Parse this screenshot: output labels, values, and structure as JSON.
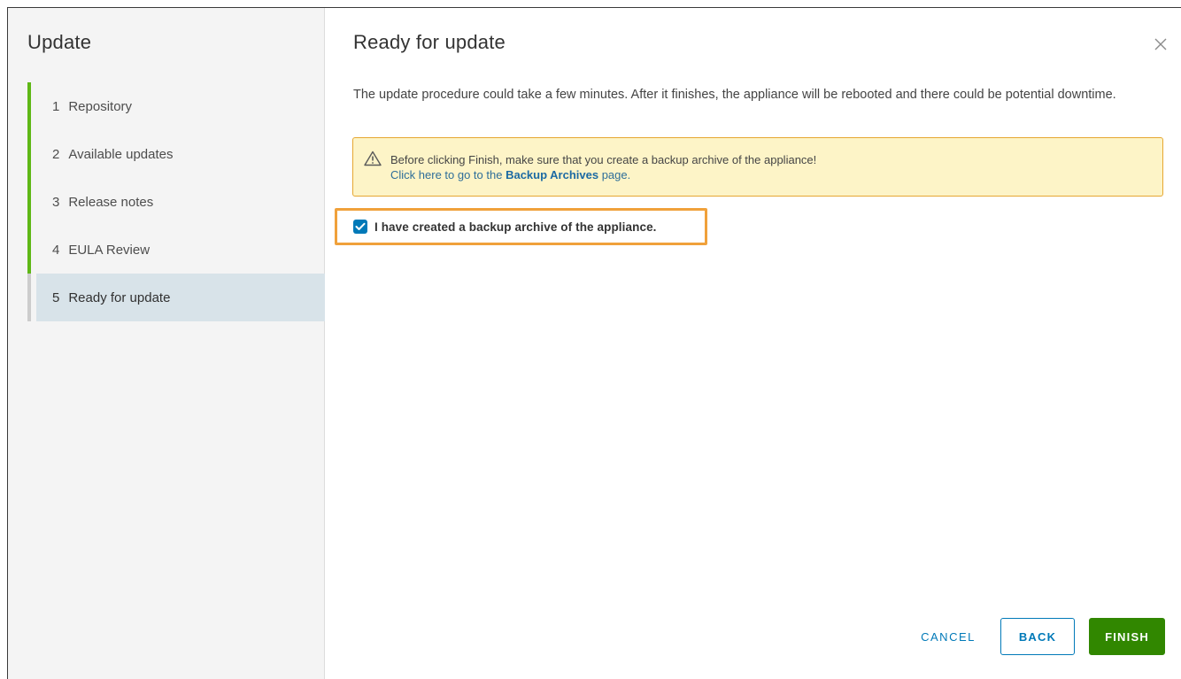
{
  "sidebar": {
    "title": "Update",
    "steps": [
      {
        "num": "1",
        "label": "Repository"
      },
      {
        "num": "2",
        "label": "Available updates"
      },
      {
        "num": "3",
        "label": "Release notes"
      },
      {
        "num": "4",
        "label": "EULA Review"
      },
      {
        "num": "5",
        "label": "Ready for update"
      }
    ]
  },
  "main": {
    "title": "Ready for update",
    "description": "The update procedure could take a few minutes. After it finishes, the appliance will be rebooted and there could be potential downtime.",
    "alert": {
      "line1": "Before clicking Finish, make sure that you create a backup archive of the appliance!",
      "line2_prefix": "Click here to go to the ",
      "link": "Backup Archives",
      "line2_suffix": " page."
    },
    "checkbox": {
      "label": "I have created a backup archive of the appliance.",
      "checked": true
    }
  },
  "footer": {
    "cancel": "CANCEL",
    "back": "BACK",
    "finish": "FINISH"
  },
  "colors": {
    "accent": "#0079b8",
    "progress": "#5eb715",
    "finish": "#318700",
    "warning_border": "#e6a732",
    "highlight": "#f0a13b"
  },
  "icons": {
    "close": "close-icon",
    "warning": "warning-icon",
    "check": "checkmark-icon"
  }
}
